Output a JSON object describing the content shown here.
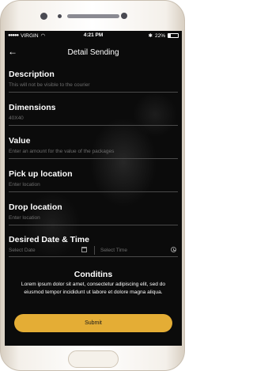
{
  "status": {
    "carrier": "VIRGIN",
    "time": "4:21 PM",
    "battery": "22%"
  },
  "header": {
    "back_icon": "arrow-left-icon",
    "title": "Detail Sending"
  },
  "fields": [
    {
      "label": "Description",
      "placeholder": "This will not be visible to the courier"
    },
    {
      "label": "Dimensions",
      "placeholder": "40X40"
    },
    {
      "label": "Value",
      "placeholder": "Enter an amount for the value of the packages"
    },
    {
      "label": "Pick up location",
      "placeholder": "Enter location"
    },
    {
      "label": "Drop location",
      "placeholder": "Enter location"
    }
  ],
  "datetime": {
    "label": "Desired Date & Time",
    "date_placeholder": "Select Date",
    "time_placeholder": "Select Time"
  },
  "conditions": {
    "title": "Conditins",
    "body": "Lorem ipsum dolor sit amet, consectetur adipiscing elit, sed do eiusmod tempor incididunt ut labore et dolore magna aliqua."
  },
  "submit_label": "Submit",
  "colors": {
    "accent": "#e4ad35",
    "background": "#0b0b0b"
  }
}
